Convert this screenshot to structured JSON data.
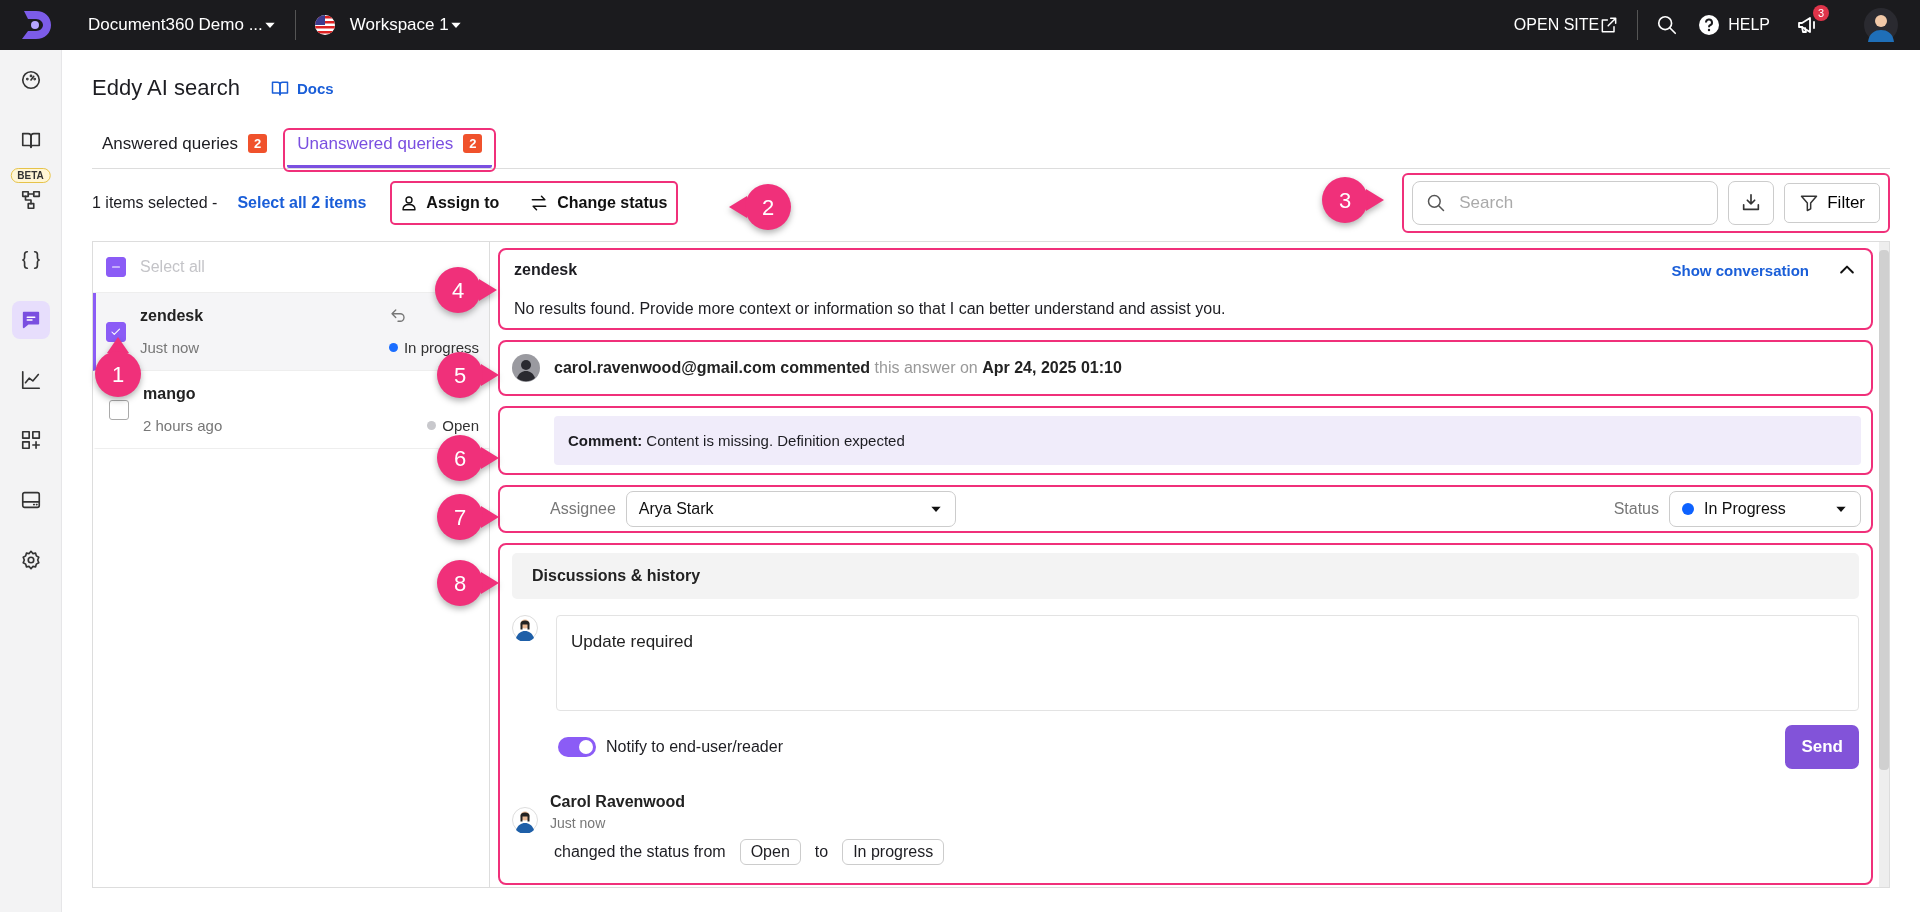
{
  "topbar": {
    "project": "Document360 Demo ...",
    "workspace": "Workspace 1",
    "open_site": "OPEN SITE",
    "help": "HELP",
    "notifications_badge": "3"
  },
  "sidebar": {
    "items": [
      {
        "kind": "dashboard",
        "selected": false
      },
      {
        "kind": "book",
        "selected": false
      },
      {
        "kind": "diagram",
        "selected": false,
        "badge": "BETA"
      },
      {
        "kind": "braces",
        "selected": false
      },
      {
        "kind": "chat",
        "selected": true
      },
      {
        "kind": "chart",
        "selected": false
      },
      {
        "kind": "apps",
        "selected": false
      },
      {
        "kind": "drive",
        "selected": false
      },
      {
        "kind": "gear",
        "selected": false
      }
    ]
  },
  "page": {
    "title": "Eddy AI search",
    "docs_link": "Docs"
  },
  "tabs": [
    {
      "label": "Answered queries",
      "count": "2",
      "selected": false
    },
    {
      "label": "Unanswered queries",
      "count": "2",
      "selected": true
    }
  ],
  "toolbar": {
    "selection_text": "1 items selected -",
    "select_all_link": "Select all 2 items",
    "assign_to": "Assign to",
    "change_status": "Change status",
    "search": {
      "placeholder": "Search"
    },
    "filter": "Filter"
  },
  "query_list": {
    "select_all": {
      "label": "Select all",
      "indeterminate": true
    },
    "items": [
      {
        "title": "zendesk",
        "time": "Just now",
        "status": "In progress",
        "color": "#1a6dff",
        "checked": true,
        "selected": true
      },
      {
        "title": "mango",
        "time": "2 hours ago",
        "status": "Open",
        "color": "#c8c8cc",
        "checked": false,
        "selected": false
      }
    ]
  },
  "detail": {
    "query": {
      "title": "zendesk",
      "show_conversation": "Show conversation",
      "expanded": true,
      "answer": "No results found. Provide more context or information so that I can better understand and assist you."
    },
    "comment_meta": "**carol.ravenwood@gmail.com commented** this answer on **Apr 24, 2025 01:10**",
    "comment": "**Comment:** Content is missing. Definition expected",
    "assignee": {
      "label": "Assignee",
      "value": "Arya Stark"
    },
    "status": {
      "label": "Status",
      "value": "In Progress",
      "color": "#0d62ff"
    },
    "discussion": {
      "heading": "Discussions & history",
      "reply_value": "Update required",
      "notify": {
        "label": "Notify to end-user/reader",
        "on": true
      },
      "send": "Send",
      "history": [
        {
          "author": "Carol Ravenwood",
          "time": "Just now",
          "text": "changed the status from",
          "from": "Open",
          "connector": "to",
          "to": "In progress"
        }
      ]
    }
  },
  "callouts": [
    {
      "number": "1",
      "kind": "up"
    },
    {
      "number": "2",
      "kind": "left"
    },
    {
      "number": "3",
      "kind": "right"
    },
    {
      "number": "4",
      "kind": "right"
    },
    {
      "number": "5",
      "kind": "right"
    },
    {
      "number": "6",
      "kind": "right"
    },
    {
      "number": "7",
      "kind": "right"
    },
    {
      "number": "8",
      "kind": "right"
    }
  ]
}
